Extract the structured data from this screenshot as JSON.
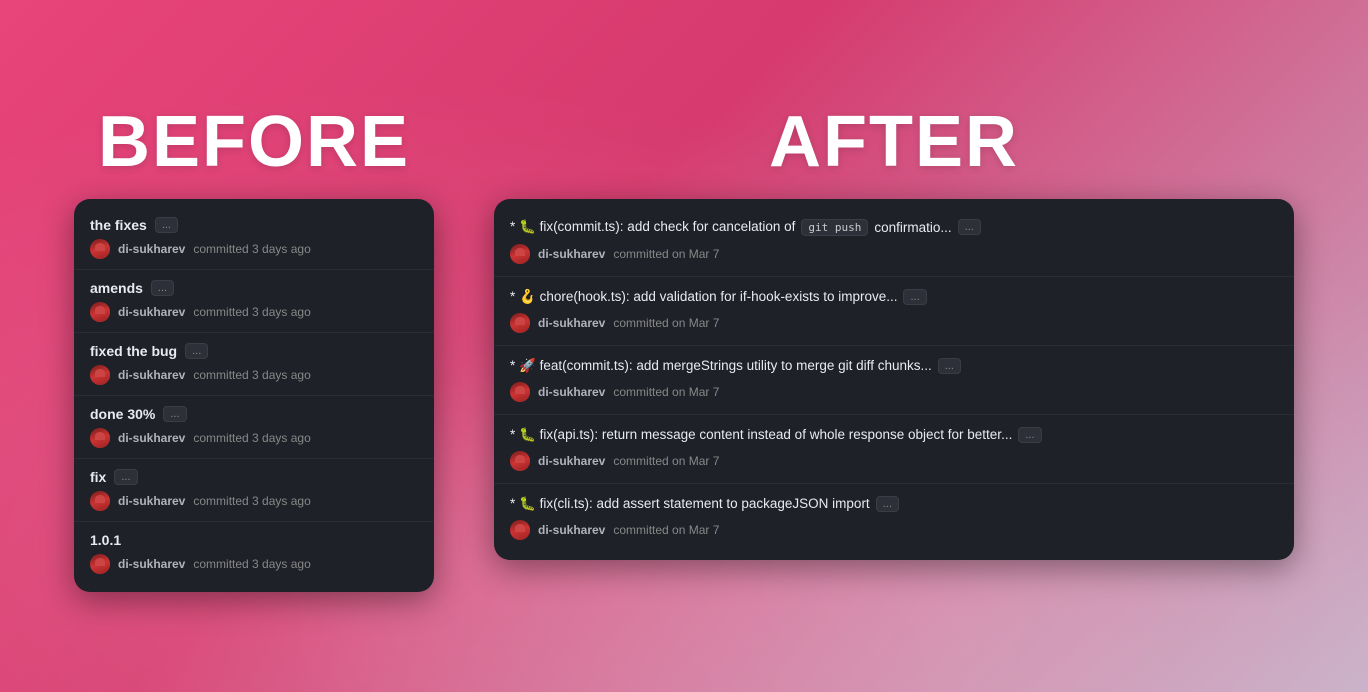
{
  "before": {
    "label": "BEFORE",
    "commits": [
      {
        "title": "the fixes",
        "author": "di-sukharev",
        "meta": "committed 3 days ago"
      },
      {
        "title": "amends",
        "author": "di-sukharev",
        "meta": "committed 3 days ago"
      },
      {
        "title": "fixed the bug",
        "author": "di-sukharev",
        "meta": "committed 3 days ago"
      },
      {
        "title": "done 30%",
        "author": "di-sukharev",
        "meta": "committed 3 days ago"
      },
      {
        "title": "fix",
        "author": "di-sukharev",
        "meta": "committed 3 days ago"
      },
      {
        "title": "1.0.1",
        "author": "di-sukharev",
        "meta": "committed 3 days ago"
      }
    ]
  },
  "after": {
    "label": "AFTER",
    "commits": [
      {
        "emoji": "🐛",
        "title_pre": "* 🐛 fix(commit.ts): add check for cancelation of ",
        "code": "git push",
        "title_post": " confirmatio...",
        "author": "di-sukharev",
        "meta": "committed on Mar 7"
      },
      {
        "emoji": "🪝",
        "title": "* 🪝 chore(hook.ts): add validation for if-hook-exists to improve...",
        "author": "di-sukharev",
        "meta": "committed on Mar 7"
      },
      {
        "emoji": "🚀",
        "title": "* 🚀 feat(commit.ts): add mergeStrings utility to merge git diff chunks...",
        "author": "di-sukharev",
        "meta": "committed on Mar 7"
      },
      {
        "emoji": "🐛",
        "title": "* 🐛 fix(api.ts): return message content instead of whole response object for better...",
        "author": "di-sukharev",
        "meta": "committed on Mar 7"
      },
      {
        "emoji": "🐛",
        "title": "* 🐛 fix(cli.ts): add assert statement to packageJSON import",
        "author": "di-sukharev",
        "meta": "committed on Mar 7"
      }
    ]
  },
  "badge_text": "...",
  "colors": {
    "bg_gradient_start": "#e8457a",
    "bg_gradient_end": "#c8b0c8",
    "card_bg": "#1e2128"
  }
}
